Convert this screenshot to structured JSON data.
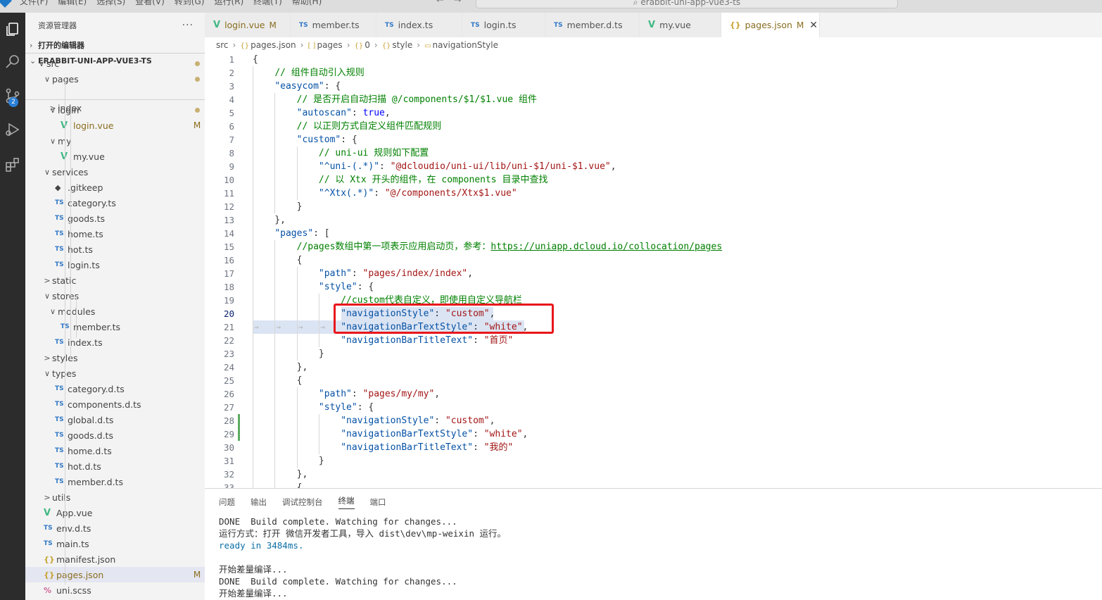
{
  "menu": [
    "文件(F)",
    "编辑(E)",
    "选择(S)",
    "查看(V)",
    "转到(G)",
    "运行(R)",
    "终端(T)",
    "帮助(H)"
  ],
  "search_text": "erabbit-uni-app-vue3-ts",
  "scm_badge": "2",
  "sidebar": {
    "title": "资源管理器",
    "more": "···",
    "open_editors": "打开的编辑器",
    "project": "ERABBIT-UNI-APP-VUE3-TS",
    "tree": [
      {
        "label": "src",
        "arrow": "∨",
        "icon": "",
        "status": "dot"
      },
      {
        "label": "pages",
        "arrow": "∨",
        "icon": "",
        "status": "dot"
      },
      {
        "label": "index",
        "arrow": ">",
        "icon": "",
        "status": ""
      },
      {
        "label": "login",
        "arrow": "∨",
        "icon": "",
        "status": "dot"
      },
      {
        "label": "login.vue",
        "arrow": "",
        "icon": "vue",
        "status": "M"
      },
      {
        "label": "my",
        "arrow": "∨",
        "icon": "",
        "status": ""
      },
      {
        "label": "my.vue",
        "arrow": "",
        "icon": "vue",
        "status": ""
      },
      {
        "label": "services",
        "arrow": "∨",
        "icon": "",
        "status": ""
      },
      {
        "label": ".gitkeep",
        "arrow": "",
        "icon": "git",
        "status": ""
      },
      {
        "label": "category.ts",
        "arrow": "",
        "icon": "ts",
        "status": ""
      },
      {
        "label": "goods.ts",
        "arrow": "",
        "icon": "ts",
        "status": ""
      },
      {
        "label": "home.ts",
        "arrow": "",
        "icon": "ts",
        "status": ""
      },
      {
        "label": "hot.ts",
        "arrow": "",
        "icon": "ts",
        "status": ""
      },
      {
        "label": "login.ts",
        "arrow": "",
        "icon": "ts",
        "status": ""
      },
      {
        "label": "static",
        "arrow": ">",
        "icon": "",
        "status": ""
      },
      {
        "label": "stores",
        "arrow": "∨",
        "icon": "",
        "status": ""
      },
      {
        "label": "modules",
        "arrow": "∨",
        "icon": "",
        "status": ""
      },
      {
        "label": "member.ts",
        "arrow": "",
        "icon": "ts",
        "status": ""
      },
      {
        "label": "index.ts",
        "arrow": "",
        "icon": "ts",
        "status": ""
      },
      {
        "label": "styles",
        "arrow": ">",
        "icon": "",
        "status": ""
      },
      {
        "label": "types",
        "arrow": "∨",
        "icon": "",
        "status": ""
      },
      {
        "label": "category.d.ts",
        "arrow": "",
        "icon": "ts",
        "status": ""
      },
      {
        "label": "components.d.ts",
        "arrow": "",
        "icon": "ts",
        "status": ""
      },
      {
        "label": "global.d.ts",
        "arrow": "",
        "icon": "ts",
        "status": ""
      },
      {
        "label": "goods.d.ts",
        "arrow": "",
        "icon": "ts",
        "status": ""
      },
      {
        "label": "home.d.ts",
        "arrow": "",
        "icon": "ts",
        "status": ""
      },
      {
        "label": "hot.d.ts",
        "arrow": "",
        "icon": "ts",
        "status": ""
      },
      {
        "label": "member.d.ts",
        "arrow": "",
        "icon": "ts",
        "status": ""
      },
      {
        "label": "utils",
        "arrow": ">",
        "icon": "",
        "status": ""
      },
      {
        "label": "App.vue",
        "arrow": "",
        "icon": "vue",
        "status": ""
      },
      {
        "label": "env.d.ts",
        "arrow": "",
        "icon": "ts",
        "status": ""
      },
      {
        "label": "main.ts",
        "arrow": "",
        "icon": "ts",
        "status": ""
      },
      {
        "label": "manifest.json",
        "arrow": "",
        "icon": "json",
        "status": ""
      },
      {
        "label": "pages.json",
        "arrow": "",
        "icon": "json",
        "status": "M"
      },
      {
        "label": "uni.scss",
        "arrow": "",
        "icon": "scss",
        "status": ""
      }
    ]
  },
  "tabs": [
    {
      "label": "login.vue",
      "icon": "vue",
      "modified": "M",
      "active": false
    },
    {
      "label": "member.ts",
      "icon": "ts",
      "modified": "",
      "active": false
    },
    {
      "label": "index.ts",
      "icon": "ts",
      "modified": "",
      "active": false
    },
    {
      "label": "login.ts",
      "icon": "ts",
      "modified": "",
      "active": false
    },
    {
      "label": "member.d.ts",
      "icon": "ts",
      "modified": "",
      "active": false
    },
    {
      "label": "my.vue",
      "icon": "vue",
      "modified": "",
      "active": false
    },
    {
      "label": "pages.json",
      "icon": "json",
      "modified": "M",
      "active": true
    }
  ],
  "icon_labels": {
    "ts": "TS",
    "vue": "V",
    "json": "{}",
    "git": "◆",
    "scss": "%"
  },
  "close_glyph": "✕",
  "breadcrumb": [
    "src",
    "pages.json",
    "pages",
    "0",
    "style",
    "navigationStyle"
  ],
  "breadcrumb_icons": [
    "",
    "{}",
    "[ ]",
    "{}",
    "{}",
    "▭"
  ],
  "code_lines": [
    "{",
    "    // 组件自动引入规则",
    "    \"easycom\": {",
    "        // 是否开启自动扫描 @/components/$1/$1.vue 组件",
    "        \"autoscan\": true,",
    "        // 以正则方式自定义组件匹配规则",
    "        \"custom\": {",
    "            // uni-ui 规则如下配置",
    "            \"^uni-(.*)\": \"@dcloudio/uni-ui/lib/uni-$1/uni-$1.vue\",",
    "            // 以 Xtx 开头的组件，在 components 目录中查找",
    "            \"^Xtx(.*)\": \"@/components/Xtx$1.vue\"",
    "        }",
    "    },",
    "    \"pages\": [",
    "        //pages数组中第一项表示应用启动页，参考：https://uniapp.dcloud.io/collocation/pages",
    "        {",
    "            \"path\": \"pages/index/index\",",
    "            \"style\": {",
    "                //custom代表自定义，即使用自定义导航栏",
    "                \"navigationStyle\": \"custom\",",
    "                \"navigationBarTextStyle\": \"white\",",
    "                \"navigationBarTitleText\": \"首页\"",
    "            }",
    "        },",
    "        {",
    "            \"path\": \"pages/my/my\",",
    "            \"style\": {",
    "                \"navigationStyle\": \"custom\",",
    "                \"navigationBarTextStyle\": \"white\",",
    "                \"navigationBarTitleText\": \"我的\"",
    "            }",
    "        },",
    "        {"
  ],
  "current_line": 20,
  "panel": {
    "tabs": [
      "问题",
      "输出",
      "调试控制台",
      "终端",
      "端口"
    ],
    "active_tab": "终端",
    "terminal": [
      "DONE  Build complete. Watching for changes...",
      "运行方式：打开 微信开发者工具，导入 dist\\dev\\mp-weixin 运行。",
      "ready in 3484ms.",
      "",
      "开始差量编译...",
      "DONE  Build complete. Watching for changes...",
      "开始差量编译..."
    ]
  },
  "colors": {
    "accent": "#2b7fd6",
    "highlight_box": "#e8171b",
    "modified": "#8a6d1e"
  }
}
